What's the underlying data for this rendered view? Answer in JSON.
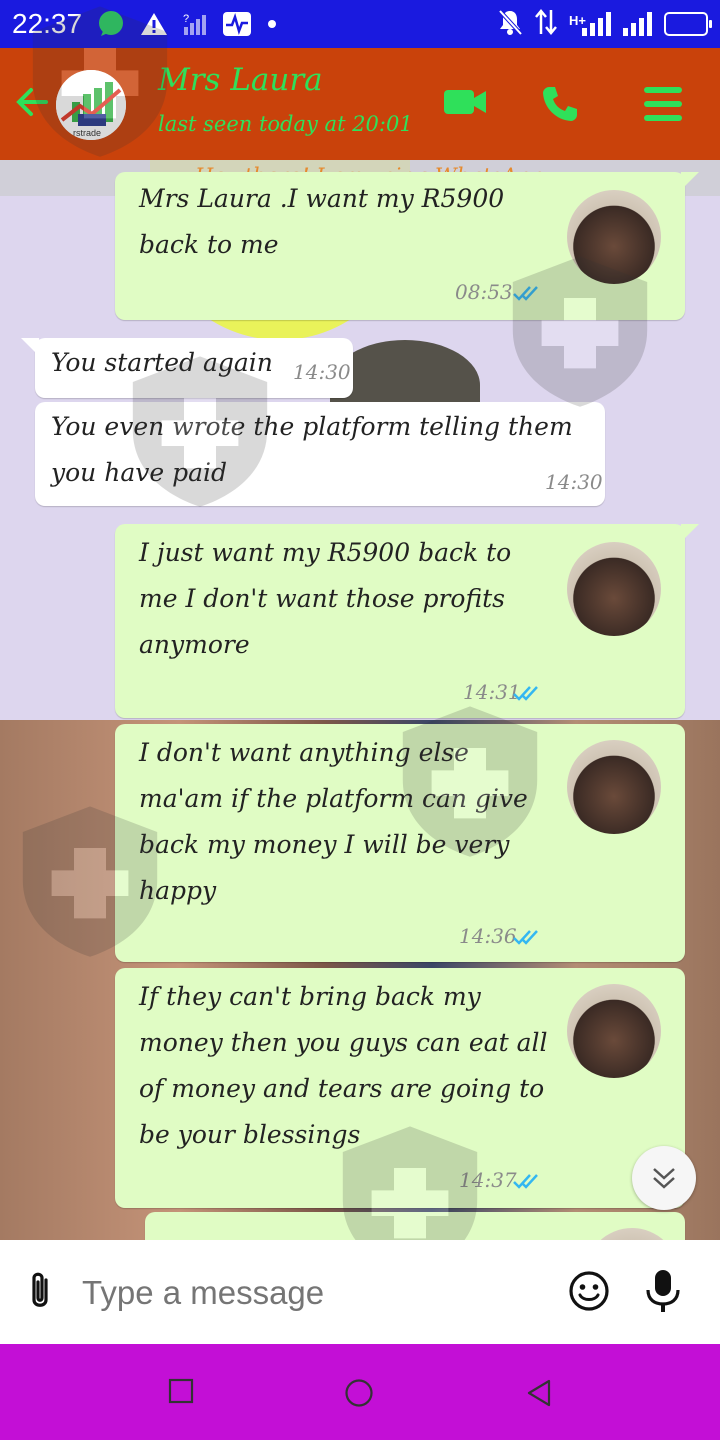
{
  "status_bar": {
    "time": "22:37",
    "network": "H+",
    "icons": [
      "whatsapp-icon",
      "warning-icon",
      "no-signal-icon",
      "activity-icon",
      "dot-icon",
      "mute-icon",
      "data-arrows-icon",
      "signal-icon",
      "battery-icon"
    ]
  },
  "header": {
    "contact_name": "Mrs Laura",
    "last_seen": "last seen today at 20:01",
    "avatar_text": "rstrade",
    "colors": {
      "bar": "#c9420b",
      "accent": "#2fe05a"
    }
  },
  "profile_status": "Hey there! I am using WhatsApp.",
  "messages": [
    {
      "direction": "out",
      "text": [
        "Mrs Laura .I want my R5900",
        "back to me"
      ],
      "time": "08:53",
      "read": true
    },
    {
      "direction": "in",
      "text": [
        "You started again"
      ],
      "time": "14:30"
    },
    {
      "direction": "in",
      "text": [
        "You even wrote the platform telling them",
        "you have paid"
      ],
      "time": "14:30"
    },
    {
      "direction": "out",
      "text": [
        "I just want my R5900 back to",
        "me I don't want those profits",
        "anymore"
      ],
      "time": "14:31",
      "read": true
    },
    {
      "direction": "out",
      "text": [
        "I don't want anything else",
        "ma'am if the platform can give",
        "back my money I will be very",
        "happy"
      ],
      "time": "14:36",
      "read": true
    },
    {
      "direction": "out",
      "text": [
        "If they can't bring back my",
        "money then you guys can eat all",
        "of money and tears are going to",
        "be your blessings"
      ],
      "time": "14:37",
      "read": true
    }
  ],
  "composer": {
    "placeholder": "Type a message"
  },
  "colors": {
    "out_bubble": "#e0fcc4",
    "in_bubble": "#ffffff",
    "read_ticks": "#34b7f1",
    "status_bar": "#1a1adf",
    "nav_bar": "#c30fd6"
  }
}
